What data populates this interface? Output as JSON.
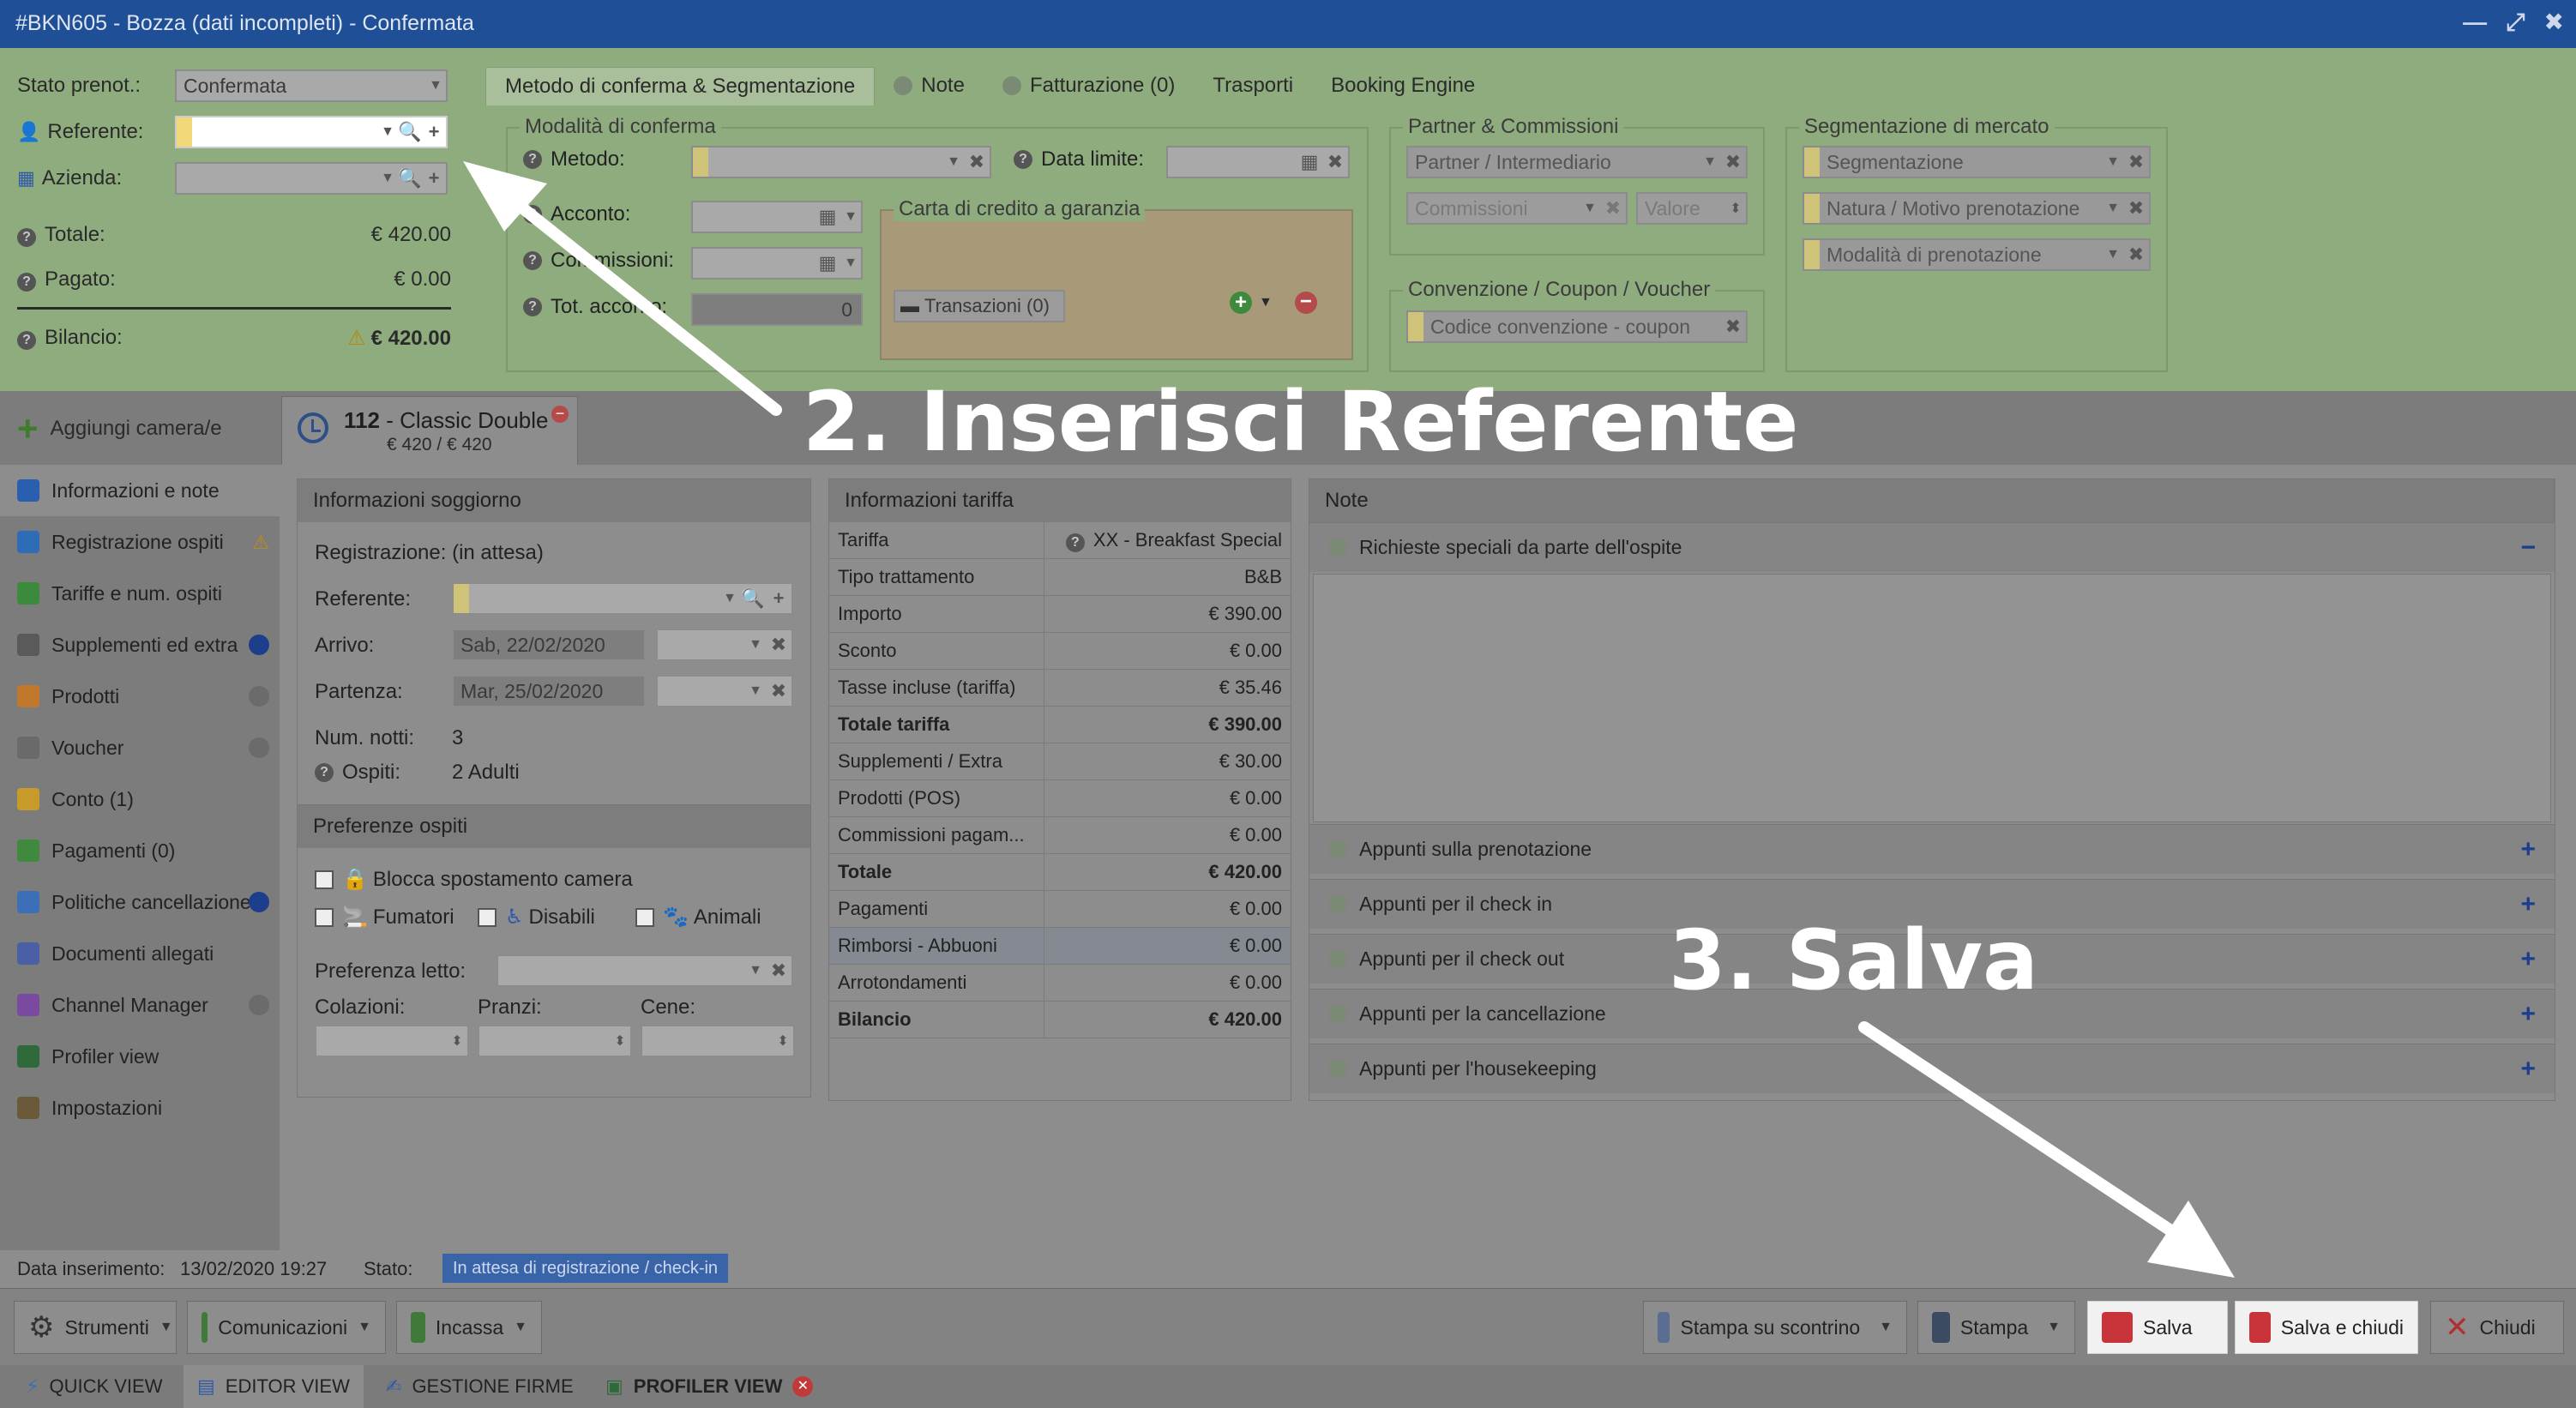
{
  "window": {
    "title": "#BKN605 - Bozza (dati incompleti) - Confermata"
  },
  "left_form": {
    "stato_label": "Stato prenot.:",
    "stato_value": "Confermata",
    "referente_label": "Referente:",
    "azienda_label": "Azienda:",
    "totale_label": "Totale:",
    "totale_value": "€ 420.00",
    "pagato_label": "Pagato:",
    "pagato_value": "€ 0.00",
    "bilancio_label": "Bilancio:",
    "bilancio_value": "€ 420.00"
  },
  "top_tabs": [
    {
      "label": "Metodo di conferma & Segmentazione"
    },
    {
      "label": "Note"
    },
    {
      "label": "Fatturazione (0)"
    },
    {
      "label": "Trasporti"
    },
    {
      "label": "Booking Engine"
    }
  ],
  "modalita": {
    "legend": "Modalità di conferma",
    "metodo_label": "Metodo:",
    "data_limite_label": "Data limite:",
    "acconto_label": "Acconto:",
    "commissioni_label": "Commissioni:",
    "tot_acconto_label": "Tot. acconto:",
    "tot_acconto_value": "0",
    "carta_legend": "Carta di credito a garanzia",
    "transazioni_label": "Transazioni (0)"
  },
  "partner": {
    "legend": "Partner & Commissioni",
    "partner_placeholder": "Partner / Intermediario",
    "commissioni_placeholder": "Commissioni",
    "valore_placeholder": "Valore"
  },
  "convenzione": {
    "legend": "Convenzione / Coupon / Voucher",
    "placeholder": "Codice convenzione - coupon"
  },
  "segmentazione": {
    "legend": "Segmentazione di mercato",
    "items": [
      "Segmentazione",
      "Natura / Motivo prenotazione",
      "Modalità di prenotazione"
    ]
  },
  "room_strip": {
    "add_label": "Aggiungi camera/e",
    "room_number": "112",
    "room_name": "- Classic Double",
    "room_price": "€ 420 / € 420"
  },
  "sidebar": {
    "items": [
      {
        "label": "Informazioni e note",
        "color": "#2a5fb0"
      },
      {
        "label": "Registrazione ospiti",
        "color": "#2e6db5"
      },
      {
        "label": "Tariffe e num. ospiti",
        "color": "#3c8a3c"
      },
      {
        "label": "Supplementi ed extra",
        "color": "#5a5a5a"
      },
      {
        "label": "Prodotti",
        "color": "#c0782c"
      },
      {
        "label": "Voucher",
        "color": "#6a6a6a"
      },
      {
        "label": "Conto (1)",
        "color": "#c79a2a"
      },
      {
        "label": "Pagamenti (0)",
        "color": "#3f8a3f"
      },
      {
        "label": "Politiche cancellazione",
        "color": "#3c6fb8"
      },
      {
        "label": "Documenti allegati",
        "color": "#4a5fa5"
      },
      {
        "label": "Channel Manager",
        "color": "#7a4aa0"
      },
      {
        "label": "Profiler view",
        "color": "#2f6b3a"
      },
      {
        "label": "Impostazioni",
        "color": "#6a5a3a"
      }
    ]
  },
  "soggiorno": {
    "header": "Informazioni soggiorno",
    "registrazione_label": "Registrazione:",
    "registrazione_value": "(in attesa)",
    "referente_label": "Referente:",
    "arrivo_label": "Arrivo:",
    "arrivo_value": "Sab, 22/02/2020",
    "partenza_label": "Partenza:",
    "partenza_value": "Mar, 25/02/2020",
    "notti_label": "Num. notti:",
    "notti_value": "3",
    "ospiti_label": "Ospiti:",
    "ospiti_value": "2 Adulti"
  },
  "preferenze": {
    "header": "Preferenze ospiti",
    "blocca_label": "Blocca spostamento camera",
    "fumatori_label": "Fumatori",
    "disabili_label": "Disabili",
    "animali_label": "Animali",
    "letto_label": "Preferenza letto:",
    "colazioni_label": "Colazioni:",
    "pranzi_label": "Pranzi:",
    "cene_label": "Cene:"
  },
  "tariffa": {
    "header": "Informazioni tariffa",
    "rows": [
      {
        "label": "Tariffa",
        "value": "XX - Breakfast Special"
      },
      {
        "label": "Tipo trattamento",
        "value": "B&B"
      },
      {
        "label": "Importo",
        "value": "€ 390.00"
      },
      {
        "label": "Sconto",
        "value": "€ 0.00"
      },
      {
        "label": "Tasse incluse (tariffa)",
        "value": "€ 35.46"
      },
      {
        "label": "Totale tariffa",
        "value": "€ 390.00"
      },
      {
        "label": "Supplementi / Extra",
        "value": "€ 30.00"
      },
      {
        "label": "Prodotti (POS)",
        "value": "€ 0.00"
      },
      {
        "label": "Commissioni pagam...",
        "value": "€ 0.00"
      },
      {
        "label": "Totale",
        "value": "€ 420.00"
      },
      {
        "label": "Pagamenti",
        "value": "€ 0.00"
      },
      {
        "label": "Rimborsi - Abbuoni",
        "value": "€ 0.00"
      },
      {
        "label": "Arrotondamenti",
        "value": "€ 0.00"
      },
      {
        "label": "Bilancio",
        "value": "€ 420.00"
      }
    ]
  },
  "note": {
    "header": "Note",
    "richieste_label": "Richieste speciali da parte dell'ospite",
    "items": [
      {
        "label": "Appunti sulla prenotazione"
      },
      {
        "label": "Appunti per il check in"
      },
      {
        "label": "Appunti per il check out"
      },
      {
        "label": "Appunti per la cancellazione"
      },
      {
        "label": "Appunti per l'housekeeping"
      }
    ]
  },
  "status": {
    "data_label": "Data inserimento:",
    "data_value": "13/02/2020 19:27",
    "stato_label": "Stato:",
    "stato_badge": "In attesa di registrazione / check-in"
  },
  "toolbar": {
    "strumenti": "Strumenti",
    "comunicazioni": "Comunicazioni",
    "incassa": "Incassa",
    "stampa_scontrino": "Stampa su scontrino",
    "stampa": "Stampa",
    "salva": "Salva",
    "salva_chiudi": "Salva e chiudi",
    "chiudi": "Chiudi"
  },
  "footer_tabs": {
    "quick": "QUICK VIEW",
    "editor": "EDITOR VIEW",
    "firme": "GESTIONE FIRME",
    "profiler": "PROFILER VIEW"
  },
  "annotations": {
    "step2": "2. Inserisci Referente",
    "step3": "3. Salva"
  }
}
